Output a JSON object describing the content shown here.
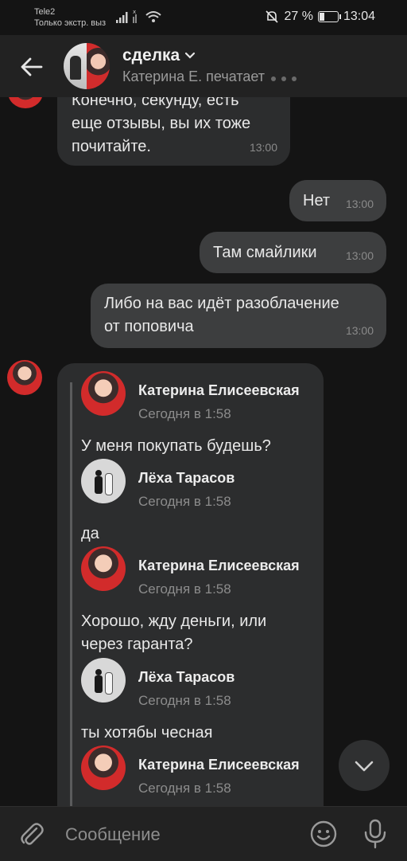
{
  "status_bar": {
    "carrier": "Tele2",
    "carrier_sub": "Только экстр. выз",
    "battery": "27 %",
    "time": "13:04"
  },
  "header": {
    "title": "сделка",
    "subtitle": "Катерина Е. печатает"
  },
  "messages": {
    "m1_line1": "Конечно, секунду, есть",
    "m1_line2": "еще отзывы, вы их тоже",
    "m1_line3": "почитайте.",
    "m1_time": "13:00",
    "m2_text": "Нет",
    "m2_time": "13:00",
    "m3_text": "Там смайлики",
    "m3_time": "13:00",
    "m4_line1": "Либо на вас идёт разоблачение",
    "m4_line2": "от поповича",
    "m4_time": "13:00"
  },
  "forwarded": [
    {
      "name": "Катерина Елисеевская",
      "date": "Сегодня в 1:58",
      "text": "У меня покупать будешь?"
    },
    {
      "name": "Лёха Тарасов",
      "date": "Сегодня в 1:58",
      "text": "да"
    },
    {
      "name": "Катерина Елисеевская",
      "date": "Сегодня в 1:58",
      "text": "Хорошо, жду деньги, или через гаранта?"
    },
    {
      "name": "Лёха Тарасов",
      "date": "Сегодня в 1:58",
      "text": "ты хотябы чесная"
    },
    {
      "name": "Катерина Елисеевская",
      "date": "Сегодня в 1:58",
      "text": ""
    }
  ],
  "composer": {
    "placeholder": "Сообщение"
  },
  "colors": {
    "background": "#141414",
    "header": "#222222",
    "bubble_in": "#2c2d2e",
    "bubble_out": "#3d3e3f"
  }
}
